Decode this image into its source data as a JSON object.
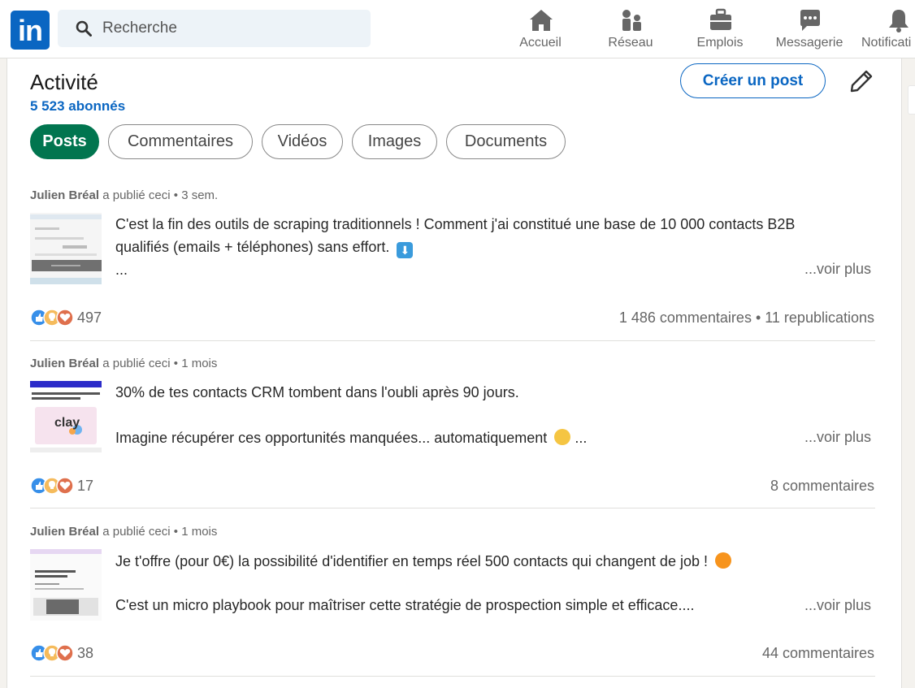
{
  "nav": {
    "logo_text": "in",
    "search_placeholder": "Recherche",
    "items": [
      {
        "label": "Accueil",
        "icon": "home-icon"
      },
      {
        "label": "Réseau",
        "icon": "network-icon"
      },
      {
        "label": "Emplois",
        "icon": "briefcase-icon"
      },
      {
        "label": "Messagerie",
        "icon": "messaging-icon"
      },
      {
        "label": "Notificati",
        "icon": "bell-icon"
      }
    ]
  },
  "activity": {
    "title": "Activité",
    "followers": "5 523 abonnés",
    "create_post": "Créer un post",
    "filters": [
      "Posts",
      "Commentaires",
      "Vidéos",
      "Images",
      "Documents"
    ],
    "active_filter": "Posts"
  },
  "posts": [
    {
      "author": "Julien Bréal",
      "action": "a publié ceci",
      "time": "• 3 sem.",
      "line1": "C'est la fin des outils de scraping traditionnels ! Comment j'ai constitué une base de 10 000 contacts B2B",
      "line2": "qualifiés (emails + téléphones) sans effort.",
      "line3": "...",
      "line2_emoji": "down-arrow-emoji",
      "see_more": "...voir plus",
      "reactions": "497",
      "stats": "1 486 commentaires • 11 republications"
    },
    {
      "author": "Julien Bréal",
      "action": "a publié ceci",
      "time": "• 1 mois",
      "line1": "30% de tes contacts CRM tombent dans l'oubli après 90 jours.",
      "line2": "Imagine récupérer ces opportunités manquées... automatiquement",
      "line2_suffix": "...",
      "line2_emoji": "sunglasses-emoji",
      "thumb_text": "clay",
      "see_more": "...voir plus",
      "reactions": "17",
      "stats": "8 commentaires"
    },
    {
      "author": "Julien Bréal",
      "action": "a publié ceci",
      "time": "• 1 mois",
      "line1": "Je t'offre (pour 0€) la possibilité d'identifier en temps réel 500 contacts qui changent de job !",
      "line1_emoji": "fire-emoji",
      "line2": "C'est un micro playbook pour maîtriser cette stratégie de prospection simple et efficace....",
      "see_more": "...voir plus",
      "reactions": "38",
      "stats": "44 commentaires"
    }
  ],
  "colors": {
    "brand": "#0a66c2",
    "active_pill": "#01754f",
    "like": "#378fe9",
    "celebrate": "#f5bb5c",
    "love": "#df704d"
  }
}
